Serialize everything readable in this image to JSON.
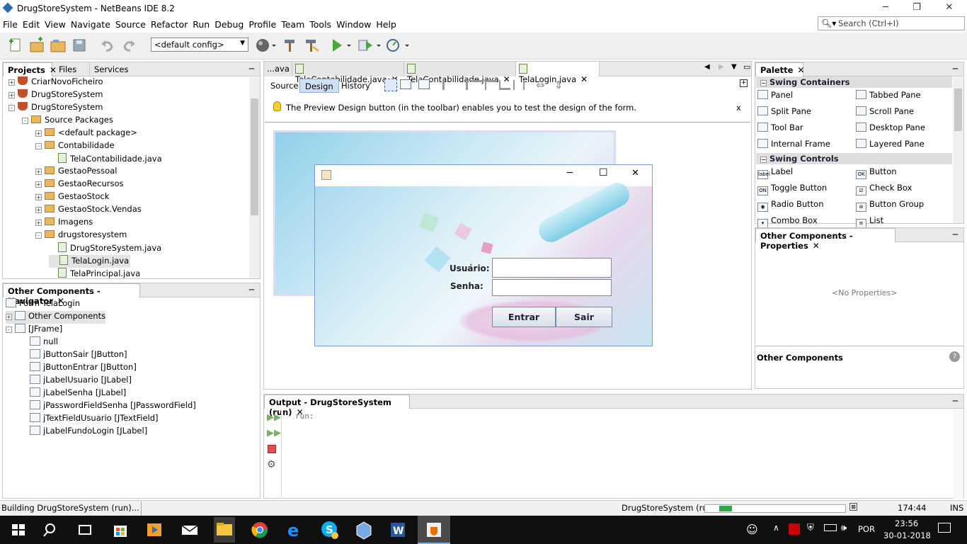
{
  "window": {
    "title": "DrugStoreSystem - NetBeans IDE 8.2"
  },
  "menu": [
    "File",
    "Edit",
    "View",
    "Navigate",
    "Source",
    "Refactor",
    "Run",
    "Debug",
    "Profile",
    "Team",
    "Tools",
    "Window",
    "Help"
  ],
  "search": {
    "placeholder": "Search (Ctrl+I)"
  },
  "toolbar": {
    "config": "<default config>"
  },
  "projects": {
    "tabs": [
      "Projects",
      "Files",
      "Services"
    ],
    "tree": [
      {
        "label": "CriarNovoFicheiro",
        "kind": "project",
        "level": 0,
        "exp": "+"
      },
      {
        "label": "DrugStoreSystem",
        "kind": "project",
        "level": 0,
        "exp": "+"
      },
      {
        "label": "DrugStoreSystem",
        "kind": "project",
        "level": 0,
        "exp": "-"
      },
      {
        "label": "Source Packages",
        "kind": "pkg",
        "level": 1,
        "exp": "-"
      },
      {
        "label": "<default package>",
        "kind": "pkg",
        "level": 2,
        "exp": "+"
      },
      {
        "label": "Contabilidade",
        "kind": "pkg",
        "level": 2,
        "exp": "-"
      },
      {
        "label": "TelaContabilidade.java",
        "kind": "file",
        "level": 3,
        "exp": ""
      },
      {
        "label": "GestaoPessoal",
        "kind": "pkg",
        "level": 2,
        "exp": "+"
      },
      {
        "label": "GestaoRecursos",
        "kind": "pkg",
        "level": 2,
        "exp": "+"
      },
      {
        "label": "GestaoStock",
        "kind": "pkg",
        "level": 2,
        "exp": "+"
      },
      {
        "label": "GestaoStock.Vendas",
        "kind": "pkg",
        "level": 2,
        "exp": "+"
      },
      {
        "label": "Imagens",
        "kind": "pkg",
        "level": 2,
        "exp": "+"
      },
      {
        "label": "drugstoresystem",
        "kind": "pkg",
        "level": 2,
        "exp": "-"
      },
      {
        "label": "DrugStoreSystem.java",
        "kind": "file",
        "level": 3,
        "exp": ""
      },
      {
        "label": "TelaLogin.java",
        "kind": "file",
        "level": 3,
        "exp": ""
      },
      {
        "label": "TelaPrincipal.java",
        "kind": "file",
        "level": 3,
        "exp": ""
      }
    ]
  },
  "navigator": {
    "title": "Other Components - Navigator",
    "items": [
      {
        "label": "Form TelaLogin",
        "level": 0,
        "exp": ""
      },
      {
        "label": "Other Components",
        "level": 0,
        "exp": "+"
      },
      {
        "label": "[JFrame]",
        "level": 0,
        "exp": "-"
      },
      {
        "label": "null",
        "level": 1,
        "exp": ""
      },
      {
        "label": "jButtonSair [JButton]",
        "level": 1,
        "exp": ""
      },
      {
        "label": "jButtonEntrar [JButton]",
        "level": 1,
        "exp": ""
      },
      {
        "label": "jLabelUsuario [JLabel]",
        "level": 1,
        "exp": ""
      },
      {
        "label": "jLabelSenha [JLabel]",
        "level": 1,
        "exp": ""
      },
      {
        "label": "jPasswordFieldSenha [JPasswordField]",
        "level": 1,
        "exp": ""
      },
      {
        "label": "jTextFieldUsuario [JTextField]",
        "level": 1,
        "exp": ""
      },
      {
        "label": "jLabelFundoLogin [JLabel]",
        "level": 1,
        "exp": ""
      }
    ]
  },
  "editor": {
    "tabs": [
      "...ava",
      "TelaContabilidade.java",
      "TelaContabilidade.java",
      "TelaLogin.java"
    ],
    "views": [
      "Source",
      "Design",
      "History"
    ],
    "hint": "The Preview Design button (in the toolbar) enables you to test the design of the form.",
    "hint_close": "x"
  },
  "login_form": {
    "usuario_label": "Usuário:",
    "senha_label": "Senha:",
    "entrar": "Entrar",
    "sair": "Sair"
  },
  "palette": {
    "title": "Palette",
    "containers_title": "Swing Containers",
    "containers": [
      "Panel",
      "Tabbed Pane",
      "Split Pane",
      "Scroll Pane",
      "Tool Bar",
      "Desktop Pane",
      "Internal Frame",
      "Layered Pane"
    ],
    "controls_title": "Swing Controls",
    "controls": [
      "Label",
      "Button",
      "Toggle Button",
      "Check Box",
      "Radio Button",
      "Button Group",
      "Combo Box",
      "List"
    ],
    "control_icons": [
      "label",
      "OK",
      "ON",
      "☑",
      "◉",
      "⊜",
      "▾",
      "≡"
    ]
  },
  "properties": {
    "title": "Other Components - Properties",
    "empty": "<No Properties>",
    "footer": "Other Components"
  },
  "output": {
    "title": "Output - DrugStoreSystem (run)",
    "text": "run:"
  },
  "status": {
    "left": "Building DrugStoreSystem (run)...",
    "project": "DrugStoreSystem (run)",
    "position": "174:44",
    "mode": "INS",
    "progress": 0.12
  },
  "taskbar": {
    "lang": "POR",
    "time": "23:56",
    "date": "30-01-2018"
  }
}
